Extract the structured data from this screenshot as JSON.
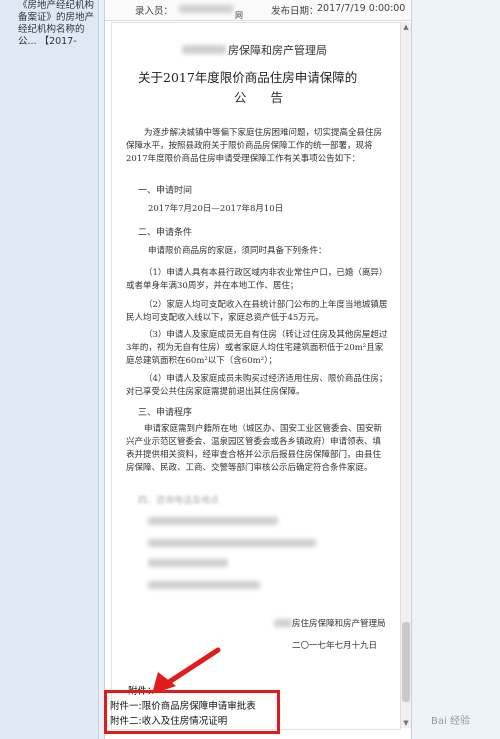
{
  "sidebar": {
    "link_text": "《房地产经纪机构备案证》的房地产经纪机构名称的公...   【2017-"
  },
  "meta": {
    "author_label": "录入员：",
    "author_value": "网",
    "date_label": "发布日期：",
    "date_value": "2017/7/19 0:00:00"
  },
  "document": {
    "issuer": "房保障和房产管理局",
    "title": "关于2017年度限价商品住房申请保障的",
    "subtitle": "公 告",
    "intro": "为逐步解决城镇中等偏下家庭住房困难问题，切实提高全县住房保障水平，按照县政府关于限价商品房保障工作的统一部署，现将2017年度限价商品住房申请受理保障工作有关事项公告如下：",
    "section1": "一、申请时间",
    "time_range": "2017年7月20日—2017年8月10日",
    "section2": "二、申请条件",
    "cond_intro": "申请限价商品房的家庭，须同时具备下列条件：",
    "cond1": "（1）申请人具有本县行政区域内非农业常住户口，已婚（离异）或者单身年满30周岁，并在本地工作、居住；",
    "cond2": "（2）家庭人均可支配收入在县统计部门公布的上年度当地城镇居民人均可支配收入线以下，家庭总资产低于45万元。",
    "cond3": "（3）申请人及家庭成员无自有住房（转让过住房及其他房屋超过3年的，视为无自有住房）或者家庭人均住宅建筑面积低于20m²且家庭总建筑面积在60m²以下（含60m²）；",
    "cond4": "（4）申请人及家庭成员未购买过经济适用住房、限价商品住房；对已享受公共住房家庭需提前退出其住房保障。",
    "section3": "三、申请程序",
    "procedure": "申请家庭需到户籍所在地（城区办、国安工业区管委会、国安新兴产业示范区管委会、温泉园区管委会或各乡镇政府）申请领表、填表并提供相关资料，经审查合格并公示后报县住房保障部门，由县住房保障、民政、工商、交警等部门审核公示后确定符合条件家庭。",
    "section4": "四、咨询电话及地点",
    "sign_org": "房住房保障和房产管理局",
    "sign_date": "二〇一七年七月十九日"
  },
  "attachments": {
    "label": "附件：",
    "item1": "附件一:限价商品房保障申请审批表",
    "item2": "附件二:收入及住房情况证明"
  },
  "annotation": {
    "arrow_color": "#e11a1a",
    "box_color": "#e11a1a"
  },
  "watermark": {
    "text": "Bai 经验"
  }
}
